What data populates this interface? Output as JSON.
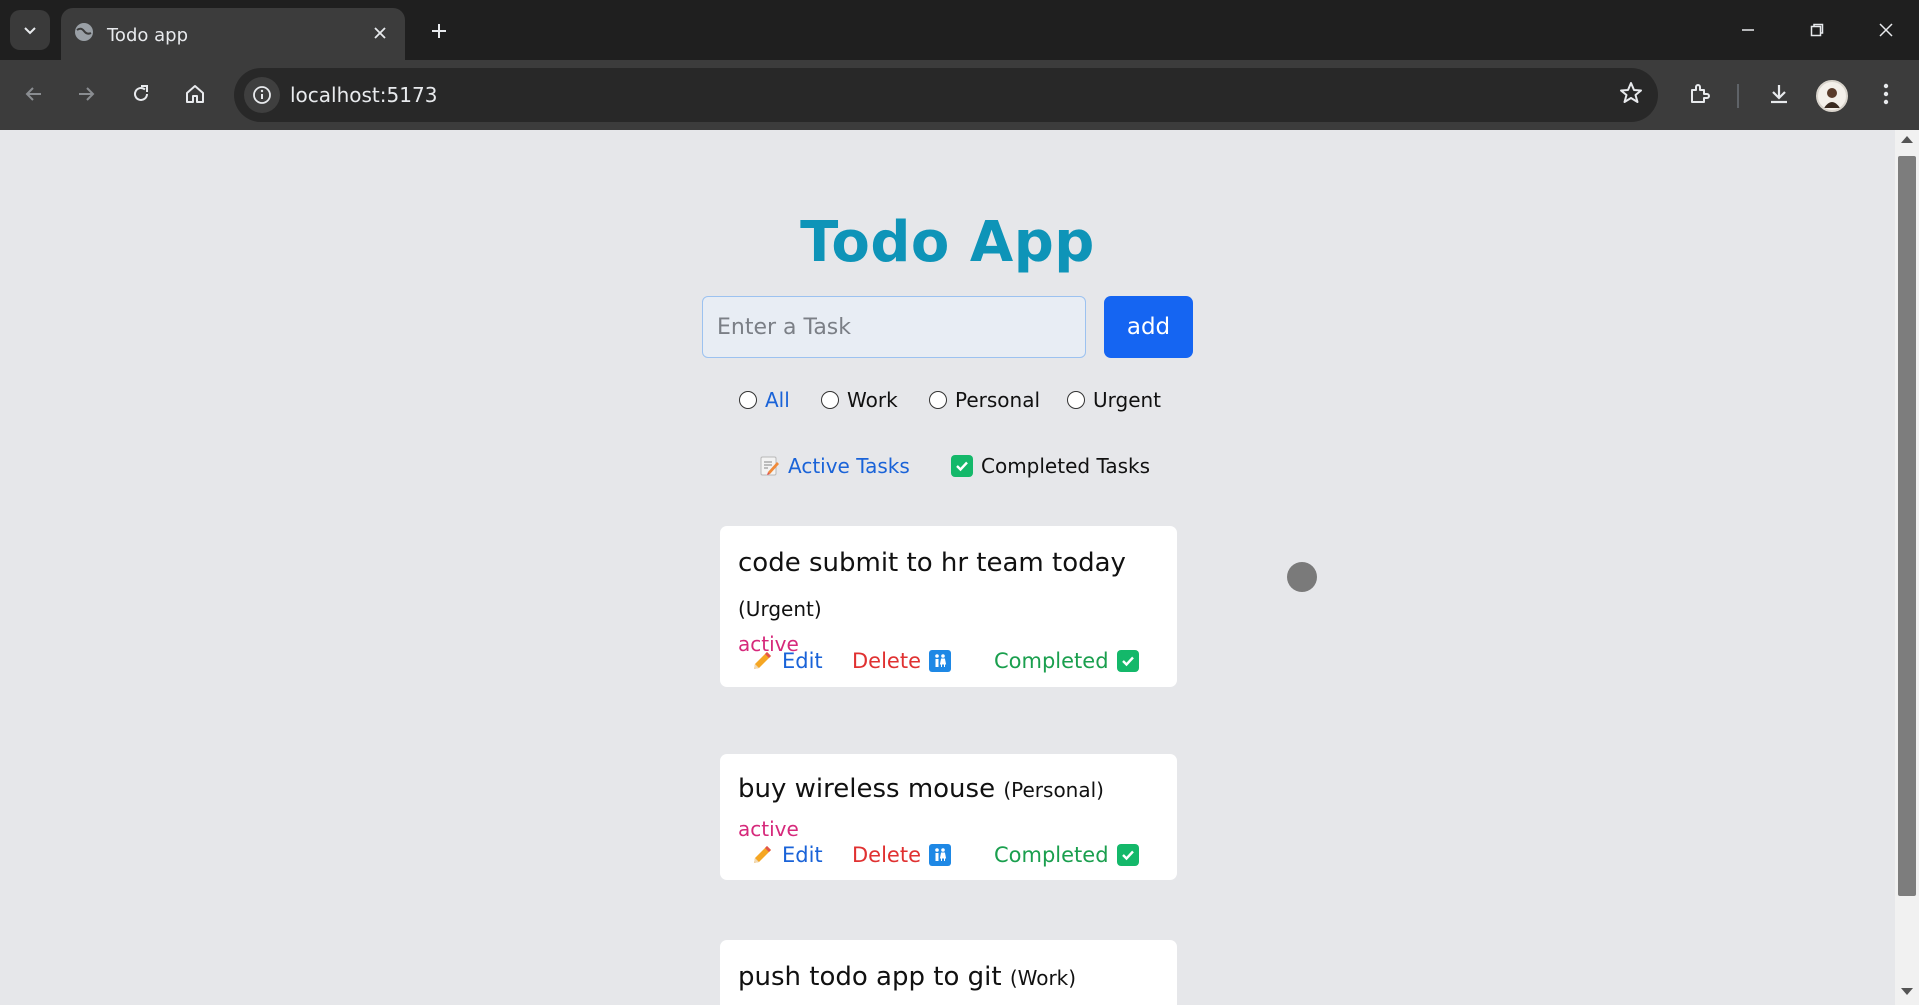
{
  "browser": {
    "tab_title": "Todo app",
    "url": "localhost:5173"
  },
  "app": {
    "title": "Todo App",
    "input_placeholder": "Enter a Task",
    "add_label": "add",
    "filters": [
      "All",
      "Work",
      "Personal",
      "Urgent"
    ],
    "selected_filter": "All",
    "views": {
      "active_label": "Active Tasks",
      "completed_label": "Completed Tasks"
    }
  },
  "tasks": [
    {
      "title": "code submit to hr team today",
      "category": "(Urgent)",
      "status": "active",
      "edit_label": "Edit",
      "delete_label": "Delete",
      "completed_label": "Completed"
    },
    {
      "title": "buy wireless mouse",
      "category": "(Personal)",
      "status": "active",
      "edit_label": "Edit",
      "delete_label": "Delete",
      "completed_label": "Completed"
    },
    {
      "title": "push todo app to git",
      "category": "(Work)"
    }
  ],
  "colors": {
    "title": "#0e94b8",
    "add_button": "#1565f2",
    "status_active": "#d6297b",
    "edit": "#1a63d8",
    "delete": "#e03131",
    "completed": "#1a9f4e"
  },
  "icons": {
    "tab_search": "chevron-down-icon",
    "favicon": "globe-icon",
    "active_view": "memo-icon",
    "completed_view": "check-box-icon",
    "edit": "pencil-icon",
    "delete": "restroom-icon",
    "completed": "check-box-icon"
  }
}
